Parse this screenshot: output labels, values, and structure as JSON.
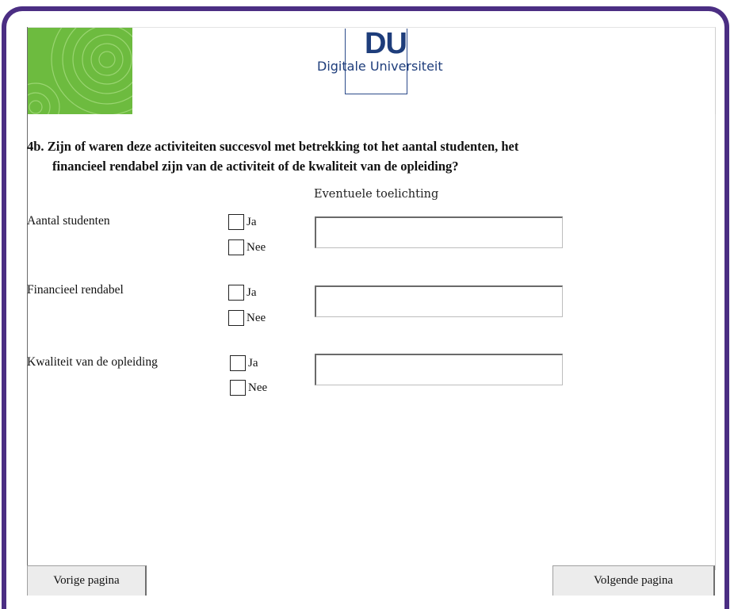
{
  "logo": {
    "letters": "DU",
    "name": "Digitale Universiteit",
    "accent_color": "#1e3d7b",
    "green_color": "#6dbb3f"
  },
  "question": {
    "number": "4b.",
    "line1": "Zijn of waren deze activiteiten succesvol met betrekking tot het aantal studenten, het",
    "line2": "financieel rendabel zijn van de activiteit of de kwaliteit van de opleiding?"
  },
  "toelichting_label": "Eventuele toelichting",
  "rows": [
    {
      "label": "Aantal studenten",
      "yes": "Ja",
      "no": "Nee",
      "note_value": ""
    },
    {
      "label": "Financieel rendabel",
      "yes": "Ja",
      "no": "Nee",
      "note_value": ""
    },
    {
      "label": "Kwaliteit van de opleiding",
      "yes": "Ja",
      "no": "Nee",
      "note_value": ""
    }
  ],
  "nav": {
    "prev": "Vorige pagina",
    "next": "Volgende pagina"
  },
  "frame_color": "#4b2e83"
}
